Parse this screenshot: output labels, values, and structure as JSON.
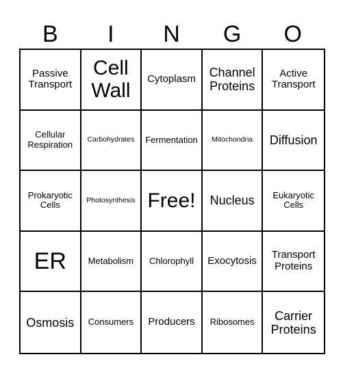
{
  "header": {
    "letters": [
      "B",
      "I",
      "N",
      "G",
      "O"
    ]
  },
  "card": {
    "rows": [
      [
        {
          "text": "Passive Transport",
          "size": "md"
        },
        {
          "text": "Cell Wall",
          "size": "xl"
        },
        {
          "text": "Cytoplasm",
          "size": "md"
        },
        {
          "text": "Channel Proteins",
          "size": "lg"
        },
        {
          "text": "Active Transport",
          "size": "md"
        }
      ],
      [
        {
          "text": "Cellular Respiration",
          "size": "sm"
        },
        {
          "text": "Carbohydrates",
          "size": "xs"
        },
        {
          "text": "Fermentation",
          "size": "sm"
        },
        {
          "text": "Mitochondria",
          "size": "xs"
        },
        {
          "text": "Diffusion",
          "size": "lg"
        }
      ],
      [
        {
          "text": "Prokaryotic Cells",
          "size": "sm"
        },
        {
          "text": "Photosynthesis",
          "size": "xs"
        },
        {
          "text": "Free!",
          "size": "xl"
        },
        {
          "text": "Nucleus",
          "size": "lg"
        },
        {
          "text": "Eukaryotic Cells",
          "size": "sm"
        }
      ],
      [
        {
          "text": "ER",
          "size": "xxl"
        },
        {
          "text": "Metabolism",
          "size": "sm"
        },
        {
          "text": "Chlorophyll",
          "size": "sm"
        },
        {
          "text": "Exocytosis",
          "size": "md"
        },
        {
          "text": "Transport Proteins",
          "size": "md"
        }
      ],
      [
        {
          "text": "Osmosis",
          "size": "lg"
        },
        {
          "text": "Consumers",
          "size": "sm"
        },
        {
          "text": "Producers",
          "size": "md"
        },
        {
          "text": "Ribosomes",
          "size": "sm"
        },
        {
          "text": "Carrier Proteins",
          "size": "lg"
        }
      ]
    ]
  },
  "colors": {
    "text": "#000000",
    "grid_line": "#000000",
    "background": "#ffffff"
  }
}
